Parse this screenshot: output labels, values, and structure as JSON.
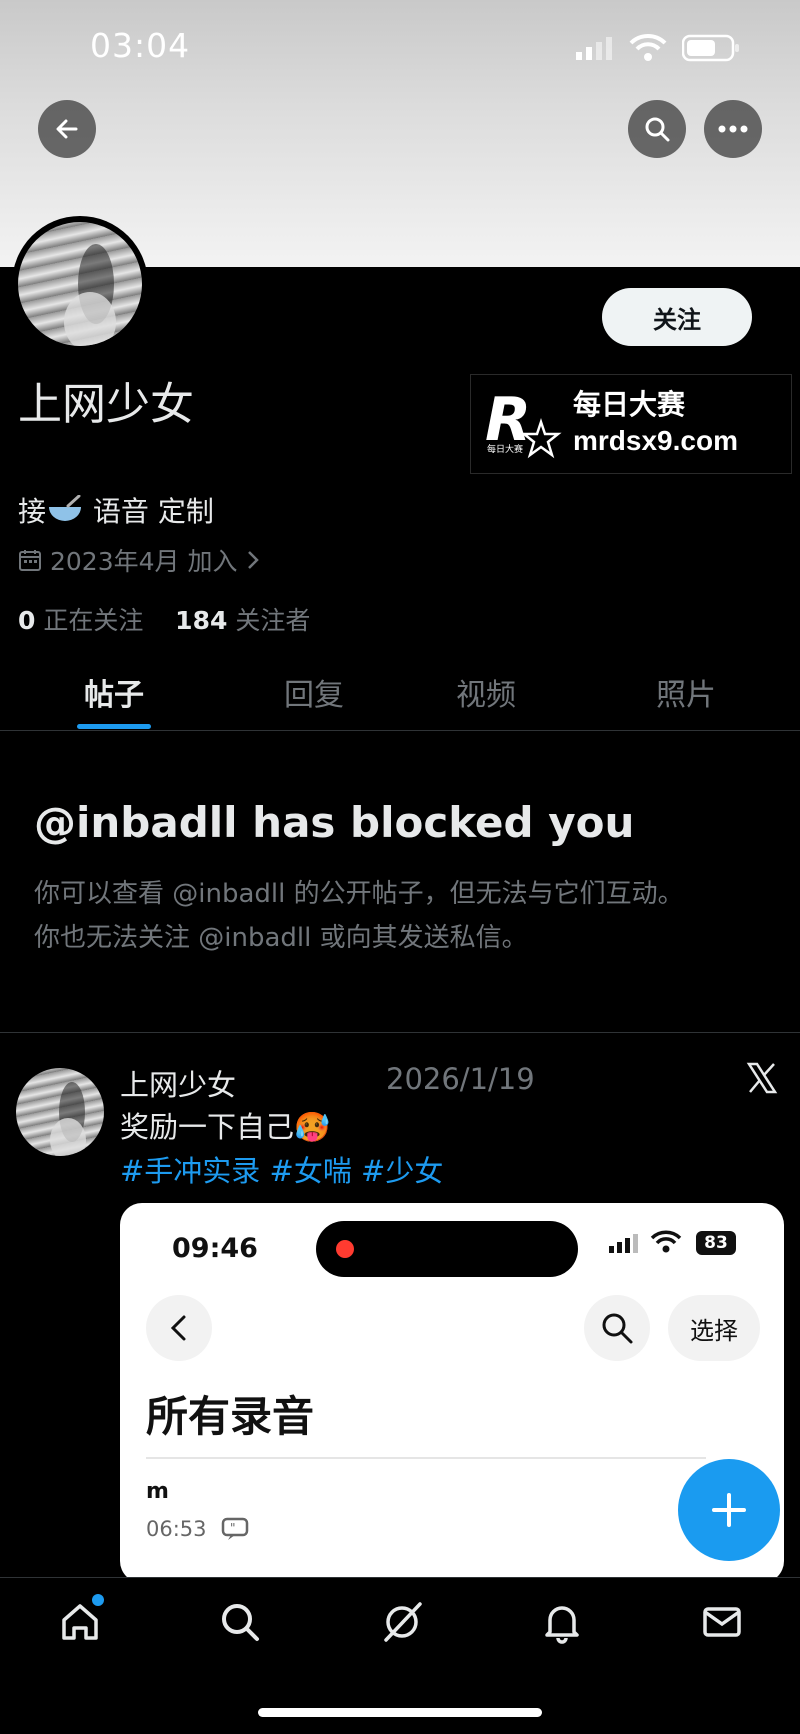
{
  "status_bar": {
    "time": "03:04"
  },
  "profile": {
    "display_name": "上网少女",
    "follow_label": "关注",
    "bio_prefix": "接",
    "bio_suffix": " 语音 定制",
    "joined": "2023年4月 加入",
    "following_count": "0",
    "following_label": "正在关注",
    "followers_count": "184",
    "followers_label": "关注者"
  },
  "watermark": {
    "line1": "每日大赛",
    "line2": "mrdsx9.com",
    "logo_small": "每日大赛",
    "logo_letter": "R"
  },
  "tabs": [
    {
      "label": "帖子",
      "active": true
    },
    {
      "label": "回复",
      "active": false
    },
    {
      "label": "视频",
      "active": false
    },
    {
      "label": "照片",
      "active": false
    }
  ],
  "blocked_notice": {
    "title": "@inbadll has blocked you",
    "line1": "你可以查看 @inbadll 的公开帖子，但无法与它们互动。",
    "line2": "你也无法关注 @inbadll 或向其发送私信。"
  },
  "post": {
    "author": "上网少女",
    "date": "2026/1/19",
    "text": "奖励一下自己🥵",
    "tags": "#手冲实录 #女喘 #少女",
    "media": {
      "time": "09:46",
      "battery": "83",
      "select_label": "选择",
      "heading": "所有录音",
      "item_name": "m",
      "item_duration": "06:53"
    }
  },
  "colors": {
    "accent": "#1d9bf0",
    "background": "#000000",
    "muted": "#71767b"
  },
  "icons": [
    "back-arrow-icon",
    "search-icon",
    "more-icon",
    "calendar-icon",
    "x-logo-icon",
    "home-icon",
    "explore-icon",
    "grok-icon",
    "bell-icon",
    "mail-icon"
  ]
}
